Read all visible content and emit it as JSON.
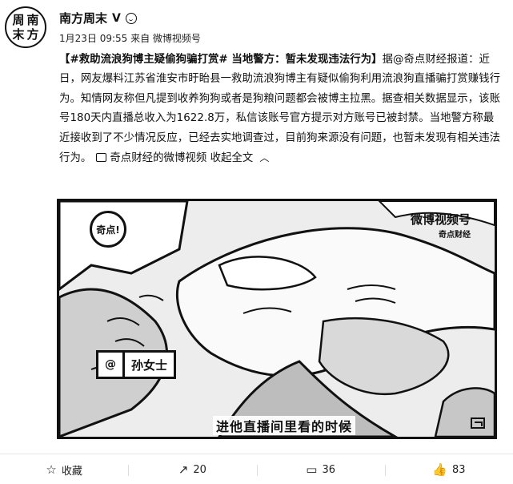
{
  "account": {
    "avatar_chars": [
      "周",
      "南",
      "末",
      "方"
    ],
    "name": "南方周末",
    "verified_badge": "V",
    "meta": "1月23日 09:55 来自 微博视频号"
  },
  "post": {
    "hashtag": "【#救助流浪狗博主疑偷狗骗打赏# 当地警方：暂未发现违法行为】",
    "body": "据@奇点财经报道：近日，网友爆料江苏省淮安市盱眙县一救助流浪狗博主有疑似偷狗利用流浪狗直播骗打赏赚钱行为。知情网友称但凡提到收养狗狗或者是狗粮问题都会被博主拉黑。据查相关数据显示，该账号180天内直播总收入为1622.8万，私信该账号官方提示对方账号已被封禁。当地警方称最近接收到了不少情况反应，已经去实地调查过，目前狗来源没有问题，也暂未发现有相关违法行为。",
    "link_label": "奇点财经的微博视频",
    "collapse_label": "收起全文"
  },
  "video": {
    "logo_text": "奇点!",
    "watermark_title": "微博视频号",
    "watermark_sub": "奇点财经",
    "name_tag_icon": "@",
    "name_tag": "孙女士",
    "subtitle": "进他直播间里看的时候"
  },
  "actions": [
    {
      "icon": "star-icon",
      "glyph": "☆",
      "label": "收藏"
    },
    {
      "icon": "share-icon",
      "glyph": "↗",
      "label": "20"
    },
    {
      "icon": "comment-icon",
      "glyph": "▭",
      "label": "36"
    },
    {
      "icon": "like-icon",
      "glyph": "👍",
      "label": "83"
    }
  ]
}
